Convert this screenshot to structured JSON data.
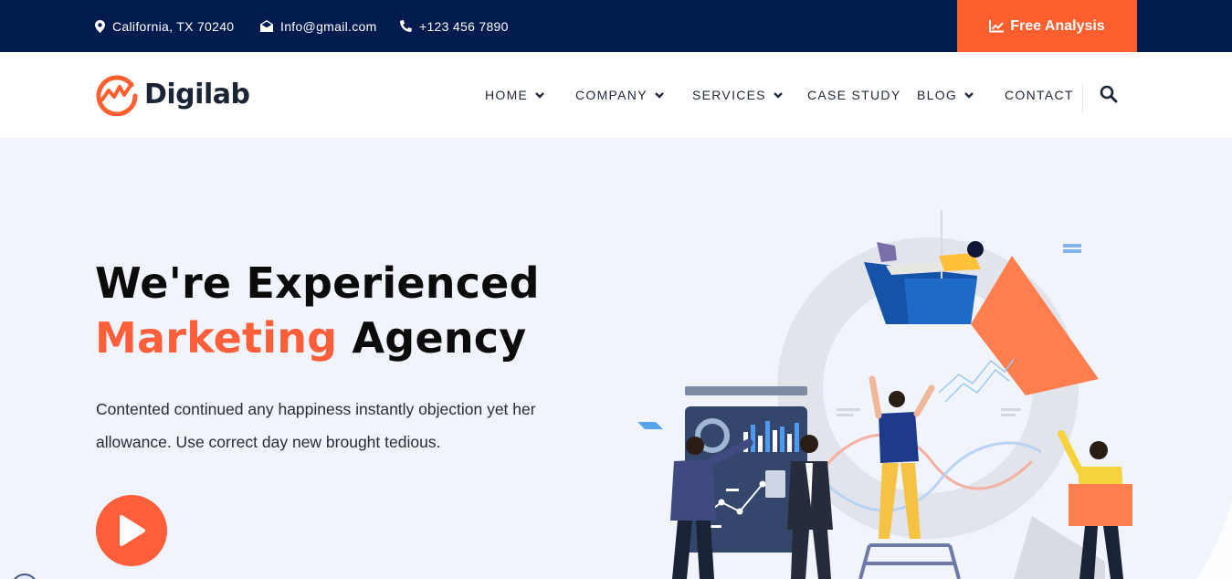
{
  "topbar": {
    "location": "California, TX 70240",
    "email": "Info@gmail.com",
    "phone": "+123 456 7890",
    "cta_label": "Free Analysis"
  },
  "brand": {
    "name": "Digilab"
  },
  "nav": {
    "items": [
      {
        "label": "HOME",
        "has_dropdown": true
      },
      {
        "label": "COMPANY",
        "has_dropdown": true
      },
      {
        "label": "SERVICES",
        "has_dropdown": true
      },
      {
        "label": "CASE STUDY",
        "has_dropdown": false
      },
      {
        "label": "BLOG",
        "has_dropdown": true
      },
      {
        "label": "CONTACT",
        "has_dropdown": false
      }
    ],
    "search_icon": "search-icon"
  },
  "hero": {
    "title_line1": "We're Experienced",
    "title_accent": "Marketing",
    "title_rest": " Agency",
    "description_line1": "Contented continued any happiness instantly objection yet her",
    "description_line2": "allowance. Use correct day new brought tedious.",
    "play_icon": "play-icon"
  },
  "colors": {
    "topbar_bg": "#011b4e",
    "accent": "#ff5e3a",
    "hero_bg": "#f1f4fb",
    "navy": "#1e3a8a"
  }
}
